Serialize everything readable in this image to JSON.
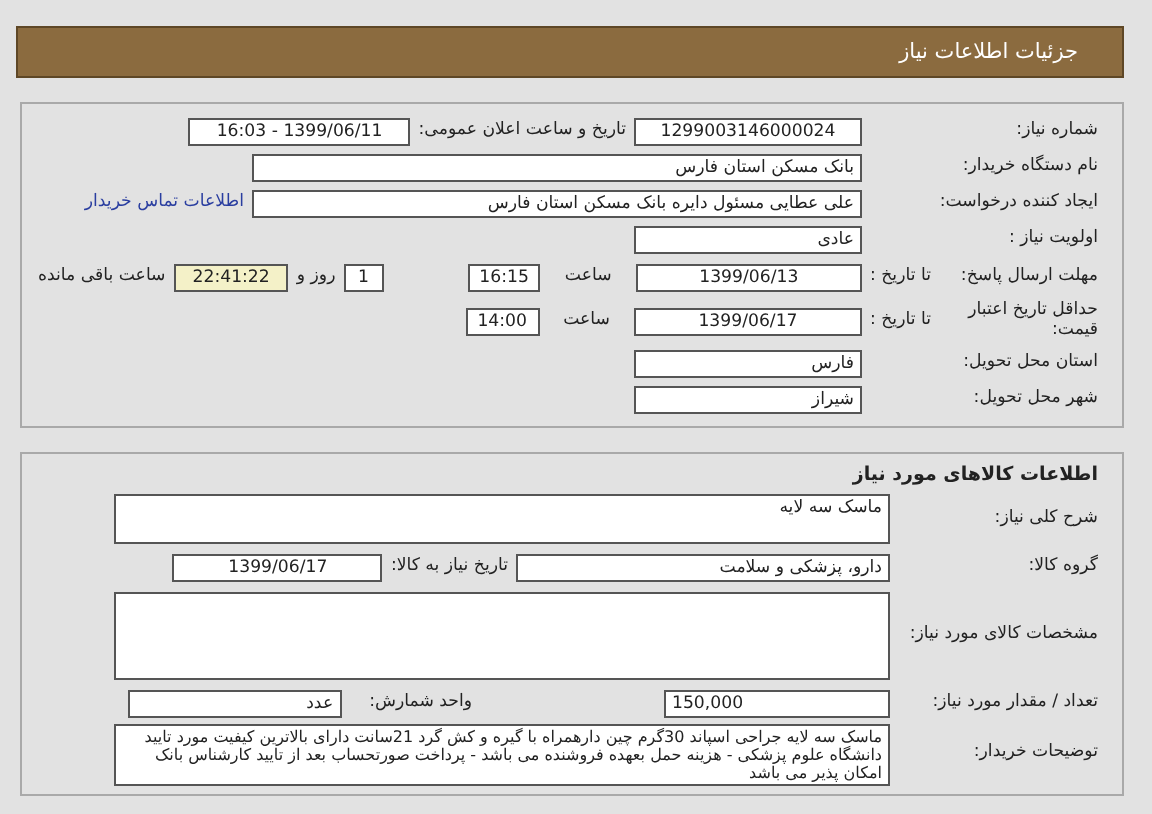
{
  "header": {
    "title": "جزئیات اطلاعات نیاز"
  },
  "need_info": {
    "need_number": {
      "label": "شماره نیاز:",
      "value": "1299003146000024"
    },
    "announce": {
      "label": "تاریخ و ساعت اعلان عمومی:",
      "value": "1399/06/11 - 16:03"
    },
    "buyer": {
      "label": "نام دستگاه خریدار:",
      "value": "بانک مسکن استان فارس"
    },
    "requester": {
      "label": "ایجاد کننده درخواست:",
      "value": "علی عطایی مسئول دایره بانک مسکن استان فارس",
      "contact_link": "اطلاعات تماس خریدار"
    },
    "priority": {
      "label": "اولویت نیاز :",
      "value": "عادی"
    },
    "deadline": {
      "label": "مهلت ارسال پاسخ:",
      "to_date_label": "تا تاریخ :",
      "date": "1399/06/13",
      "time_label": "ساعت",
      "time": "16:15",
      "days": "1",
      "days_label": "روز و",
      "remaining": "22:41:22",
      "remaining_label": "ساعت باقی مانده"
    },
    "validity": {
      "label": "حداقل تاریخ اعتبار قیمت:",
      "to_date_label": "تا تاریخ :",
      "date": "1399/06/17",
      "time_label": "ساعت",
      "time": "14:00"
    },
    "province": {
      "label": "استان محل تحویل:",
      "value": "فارس"
    },
    "city": {
      "label": "شهر محل تحویل:",
      "value": "شیراز"
    }
  },
  "goods": {
    "title": "اطلاعات کالاهای مورد نیاز",
    "summary": {
      "label": "شرح کلی نیاز:",
      "value": "ماسک سه لایه"
    },
    "group": {
      "label": "گروه کالا:",
      "value": "دارو، پزشکی و سلامت",
      "need_date_label": "تاریخ نیاز به کالا:",
      "need_date": "1399/06/17"
    },
    "specs": {
      "label": "مشخصات کالای مورد نیاز:"
    },
    "quantity": {
      "label": "تعداد / مقدار مورد نیاز:",
      "value": "150,000",
      "unit_label": "واحد شمارش:",
      "unit": "عدد"
    },
    "description": {
      "label": "توضیحات خریدار:",
      "value": "ماسک سه لایه جراحی اسپاند 30گرم چین دارهمراه با گیره و کش گرد 21سانت دارای بالاترین کیفیت مورد تایید دانشگاه علوم پزشکی - هزینه حمل بعهده فروشنده می باشد - پرداخت صورتحساب بعد از تایید کارشناس بانک امکان پذیر می باشد"
    }
  }
}
